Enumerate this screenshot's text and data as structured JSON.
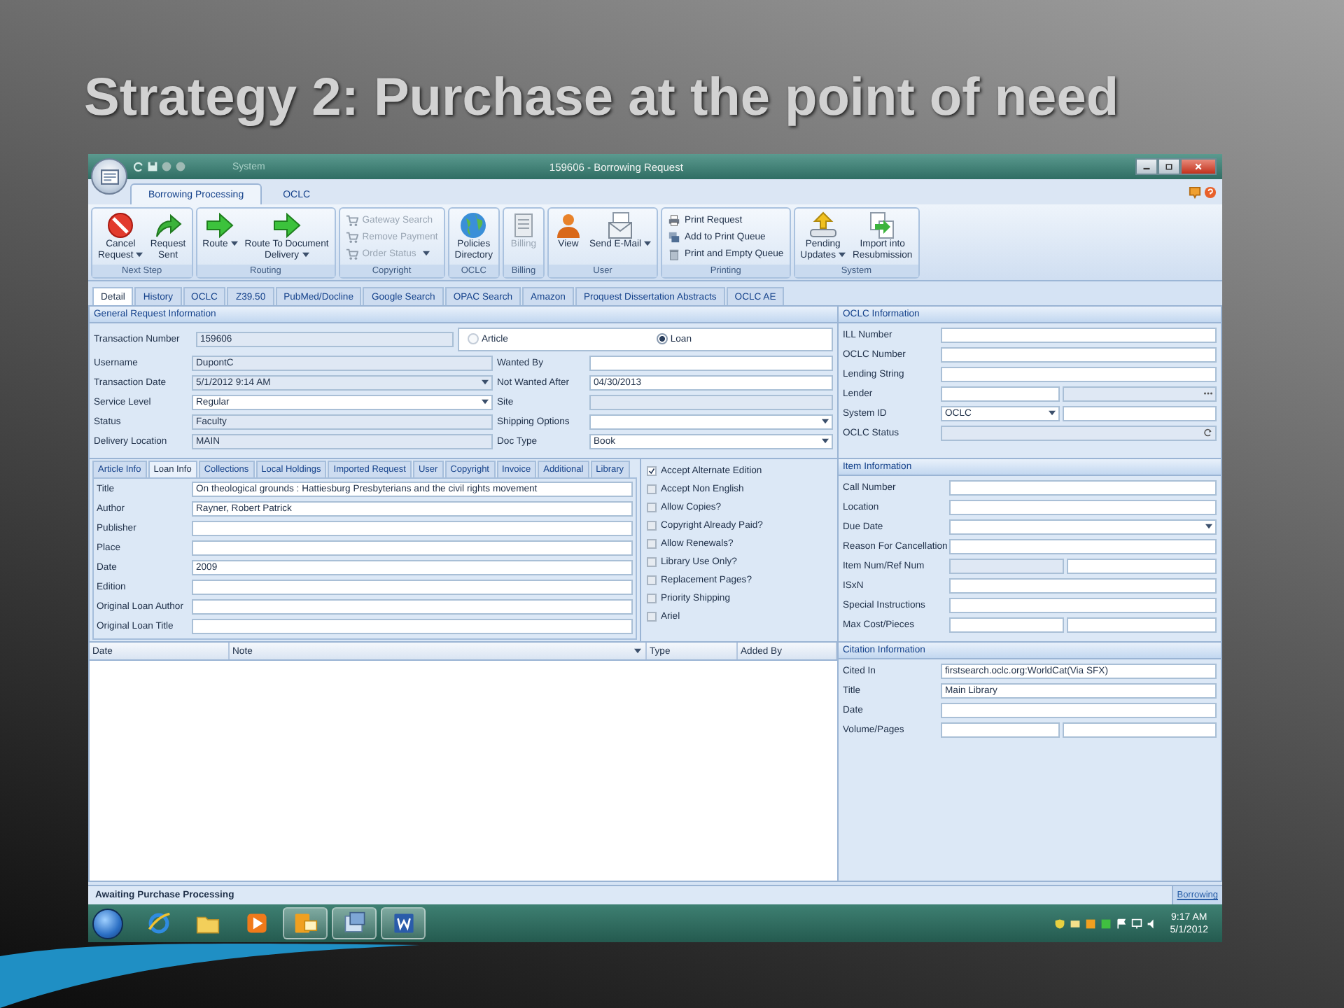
{
  "slide_title": "Strategy 2: Purchase at the point of need",
  "window": {
    "quick_label": "System",
    "title": "159606 - Borrowing Request"
  },
  "ribbon": {
    "tabs": [
      {
        "label": "Borrowing Processing",
        "selected": true
      },
      {
        "label": "OCLC",
        "selected": false
      }
    ],
    "groups": [
      {
        "label": "Next Step",
        "buttons": [
          {
            "kind": "large",
            "label": "Cancel\nRequest",
            "menu": true,
            "disabled": false
          },
          {
            "kind": "large",
            "label": "Request\nSent",
            "menu": false,
            "disabled": false
          }
        ]
      },
      {
        "label": "Routing",
        "buttons": [
          {
            "kind": "large",
            "label": "Route",
            "menu": true,
            "disabled": false
          },
          {
            "kind": "large",
            "label": "Route To Document\nDelivery",
            "menu": true,
            "disabled": false
          }
        ]
      },
      {
        "label": "Copyright",
        "buttons": [
          {
            "kind": "small",
            "label": "Gateway Search",
            "menu": false,
            "disabled": true
          },
          {
            "kind": "small",
            "label": "Remove Payment",
            "menu": false,
            "disabled": true
          },
          {
            "kind": "small",
            "label": "Order Status",
            "menu": true,
            "disabled": true
          }
        ]
      },
      {
        "label": "OCLC",
        "buttons": [
          {
            "kind": "large",
            "label": "Policies\nDirectory",
            "menu": false,
            "disabled": false
          }
        ]
      },
      {
        "label": "Billing",
        "buttons": [
          {
            "kind": "large",
            "label": "Billing",
            "menu": false,
            "disabled": true
          }
        ]
      },
      {
        "label": "User",
        "buttons": [
          {
            "kind": "large",
            "label": "View",
            "menu": false,
            "disabled": false
          },
          {
            "kind": "large",
            "label": "Send E-Mail",
            "menu": true,
            "disabled": false
          }
        ]
      },
      {
        "label": "Printing",
        "buttons": [
          {
            "kind": "small",
            "label": "Print Request",
            "menu": false,
            "disabled": false
          },
          {
            "kind": "small",
            "label": "Add to Print Queue",
            "menu": false,
            "disabled": false
          },
          {
            "kind": "small",
            "label": "Print and Empty Queue",
            "menu": false,
            "disabled": false
          }
        ]
      },
      {
        "label": "System",
        "buttons": [
          {
            "kind": "large",
            "label": "Pending\nUpdates",
            "menu": true,
            "disabled": false
          },
          {
            "kind": "large",
            "label": "Import into\nResubmission",
            "menu": false,
            "disabled": false
          }
        ]
      }
    ]
  },
  "doc_tabs": [
    {
      "label": "Detail",
      "selected": true
    },
    {
      "label": "History",
      "selected": false
    },
    {
      "label": "OCLC",
      "selected": false
    },
    {
      "label": "Z39.50",
      "selected": false
    },
    {
      "label": "PubMed/Docline",
      "selected": false
    },
    {
      "label": "Google Search",
      "selected": false
    },
    {
      "label": "OPAC Search",
      "selected": false
    },
    {
      "label": "Amazon",
      "selected": false
    },
    {
      "label": "Proquest Dissertation Abstracts",
      "selected": false
    },
    {
      "label": "OCLC AE",
      "selected": false
    }
  ],
  "general": {
    "title": "General Request Information",
    "transaction": {
      "label": "Transaction Number",
      "inputs": [
        {
          "kind": "readonly",
          "value": "159606"
        }
      ]
    },
    "record_type": [
      {
        "label": "Article",
        "selected": false
      },
      {
        "label": "Loan",
        "selected": true
      }
    ],
    "left": [
      {
        "label": "Username",
        "inputs": [
          {
            "kind": "readonly",
            "value": "DupontC"
          }
        ]
      },
      {
        "label": "Transaction Date",
        "inputs": [
          {
            "kind": "readonly_dropdown",
            "value": "5/1/2012 9:14 AM"
          }
        ]
      },
      {
        "label": "Service Level",
        "inputs": [
          {
            "kind": "dropdown",
            "value": "Regular"
          }
        ]
      },
      {
        "label": "Status",
        "inputs": [
          {
            "kind": "readonly",
            "value": "Faculty"
          }
        ]
      },
      {
        "label": "Delivery Location",
        "inputs": [
          {
            "kind": "readonly",
            "value": "MAIN"
          }
        ]
      }
    ],
    "right": [
      {
        "label": "Wanted By",
        "inputs": [
          {
            "kind": "text"
          }
        ]
      },
      {
        "label": "Not Wanted After",
        "inputs": [
          {
            "kind": "text",
            "value": "04/30/2013"
          }
        ]
      },
      {
        "label": "Site",
        "inputs": [
          {
            "kind": "readonly"
          }
        ]
      },
      {
        "label": "Shipping Options",
        "inputs": [
          {
            "kind": "dropdown"
          }
        ]
      },
      {
        "label": "Doc Type",
        "inputs": [
          {
            "kind": "dropdown",
            "value": "Book"
          }
        ]
      }
    ]
  },
  "loan": {
    "tabs": [
      {
        "label": "Article Info",
        "selected": false
      },
      {
        "label": "Loan Info",
        "selected": true
      },
      {
        "label": "Collections",
        "selected": false
      },
      {
        "label": "Local Holdings",
        "selected": false
      },
      {
        "label": "Imported Request",
        "selected": false
      },
      {
        "label": "User",
        "selected": false
      },
      {
        "label": "Copyright",
        "selected": false
      },
      {
        "label": "Invoice",
        "selected": false
      },
      {
        "label": "Additional",
        "selected": false
      },
      {
        "label": "Library",
        "selected": false
      }
    ],
    "fields": [
      {
        "label": "Title",
        "inputs": [
          {
            "kind": "text",
            "value": "On theological grounds : Hattiesburg Presbyterians and the civil rights movement"
          }
        ]
      },
      {
        "label": "Author",
        "inputs": [
          {
            "kind": "text",
            "value": "Rayner, Robert Patrick"
          }
        ]
      },
      {
        "label": "Publisher",
        "inputs": [
          {
            "kind": "text"
          }
        ]
      },
      {
        "label": "Place",
        "inputs": [
          {
            "kind": "text"
          }
        ]
      },
      {
        "label": "Date",
        "inputs": [
          {
            "kind": "text",
            "value": "2009"
          }
        ]
      },
      {
        "label": "Edition",
        "inputs": [
          {
            "kind": "text"
          }
        ]
      },
      {
        "label": "Original Loan Author",
        "inputs": [
          {
            "kind": "text"
          }
        ]
      },
      {
        "label": "Original Loan Title",
        "inputs": [
          {
            "kind": "text"
          }
        ]
      }
    ],
    "options": [
      {
        "label": "Accept Alternate Edition",
        "checked": true
      },
      {
        "label": "Accept Non English",
        "checked": false
      },
      {
        "label": "Allow Copies?",
        "checked": false
      },
      {
        "label": "Copyright Already Paid?",
        "checked": false
      },
      {
        "label": "Allow Renewals?",
        "checked": false
      },
      {
        "label": "Library Use Only?",
        "checked": false
      },
      {
        "label": "Replacement Pages?",
        "checked": false
      },
      {
        "label": "Priority Shipping",
        "checked": false
      },
      {
        "label": "Ariel",
        "checked": false
      }
    ]
  },
  "notes": {
    "columns": [
      "Date",
      "Note",
      "Type",
      "Added By"
    ]
  },
  "oclc": {
    "title": "OCLC Information",
    "fields": [
      {
        "label": "ILL Number",
        "inputs": [
          {
            "kind": "text"
          }
        ]
      },
      {
        "label": "OCLC Number",
        "inputs": [
          {
            "kind": "text"
          }
        ]
      },
      {
        "label": "Lending String",
        "inputs": [
          {
            "kind": "text"
          }
        ]
      },
      {
        "label": "Lender",
        "inputs": [
          {
            "kind": "text"
          },
          {
            "kind": "browse"
          }
        ]
      },
      {
        "label": "System ID",
        "inputs": [
          {
            "kind": "dropdown",
            "value": "OCLC"
          },
          {
            "kind": "text"
          }
        ]
      },
      {
        "label": "OCLC Status",
        "inputs": [
          {
            "kind": "status"
          }
        ]
      }
    ]
  },
  "item": {
    "title": "Item Information",
    "fields": [
      {
        "label": "Call Number",
        "inputs": [
          {
            "kind": "text"
          }
        ]
      },
      {
        "label": "Location",
        "inputs": [
          {
            "kind": "text"
          }
        ]
      },
      {
        "label": "Due Date",
        "inputs": [
          {
            "kind": "dropdown"
          }
        ]
      },
      {
        "label": "Reason For Cancellation",
        "inputs": [
          {
            "kind": "text"
          }
        ]
      },
      {
        "label": "Item Num/Ref Num",
        "inputs": [
          {
            "kind": "readonly"
          },
          {
            "kind": "text"
          }
        ]
      },
      {
        "label": "ISxN",
        "inputs": [
          {
            "kind": "text"
          }
        ]
      },
      {
        "label": "Special Instructions",
        "inputs": [
          {
            "kind": "text"
          }
        ]
      },
      {
        "label": "Max Cost/Pieces",
        "inputs": [
          {
            "kind": "text"
          },
          {
            "kind": "text"
          }
        ]
      }
    ]
  },
  "citation": {
    "title": "Citation Information",
    "fields": [
      {
        "label": "Cited In",
        "inputs": [
          {
            "kind": "text",
            "value": "firstsearch.oclc.org:WorldCat(Via SFX)"
          }
        ]
      },
      {
        "label": "Title",
        "inputs": [
          {
            "kind": "text",
            "value": "Main Library"
          }
        ]
      },
      {
        "label": "Date",
        "inputs": [
          {
            "kind": "text"
          }
        ]
      },
      {
        "label": "Volume/Pages",
        "inputs": [
          {
            "kind": "text"
          },
          {
            "kind": "text"
          }
        ]
      }
    ]
  },
  "status_bar": {
    "message": "Awaiting Purchase Processing",
    "module": "Borrowing"
  },
  "taskbar": {
    "apps": [
      {
        "active": false
      },
      {
        "active": false
      },
      {
        "active": false
      },
      {
        "active": true
      },
      {
        "active": true
      },
      {
        "active": true
      }
    ],
    "clock": {
      "time": "9:17 AM",
      "date": "5/1/2012"
    }
  }
}
